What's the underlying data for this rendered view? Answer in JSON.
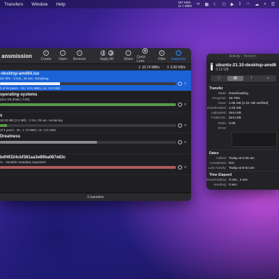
{
  "menubar": {
    "items": [
      "Transfers",
      "Window",
      "Help"
    ],
    "speed_up": "357 KB/s",
    "speed_down": "11.7 MB/s"
  },
  "window": {
    "title": "ansmission",
    "toolbar": [
      "Create",
      "Open",
      "Remove",
      "Apply All",
      "Share",
      "Quick Look",
      "Filter",
      "Inspector"
    ],
    "stats_down": "⇓ 10.74 MB/s",
    "stats_up": "⇑ 0.00 KB/s",
    "transfers": [
      {
        "name": "-desktop-amd64.iso",
        "status": "33.78% - 3 min., 40 sec. remaining",
        "detail": "3 of 93 peers - DL: 9.01 MB/s, UL: 0.0 KB/s",
        "progress": 0.34,
        "color": "#e9eef9",
        "selected": true
      },
      {
        "name": "operating-systems",
        "status": "Zero KB (Ratio: 0.00)",
        "detail": "",
        "progress": 1.0,
        "color": "#5a9a4a",
        "selected": false
      },
      {
        "name": "s",
        "status": "10.03 MB (2.2 MB) - 2 hrs, 35 sec. remaining",
        "detail": "of 3 peers - DL: 1.73 MB/s, UL: 0.0 KB/s",
        "progress": 0.04,
        "color": "#5a9a4a",
        "selected": false
      },
      {
        "name": "Dreatness",
        "status": "",
        "detail": "",
        "progress": 0.55,
        "color": "#8a8a8f",
        "selected": false
      },
      {
        "name": "bdf4f324cbf381aa3e89ba087e83c",
        "status": "% - Variable metadata requested",
        "detail": "",
        "progress": 1.0,
        "color": "#b05a5a",
        "selected": false
      }
    ],
    "footer": "5 transfers"
  },
  "inspector": {
    "window_title": "Activity - Torrent I",
    "file_name": "ubuntu-21.10-desktop-amd6",
    "file_size": "3.12 GB",
    "transfer_heading": "Transfer",
    "transfer": [
      {
        "k": "State:",
        "v": "Downloading"
      },
      {
        "k": "Progress:",
        "v": "33.78%"
      },
      {
        "k": "Have:",
        "v": "1.05 GB (1.01 GB verified)"
      },
      {
        "k": "Downloaded:",
        "v": "1.03 GB"
      },
      {
        "k": "Uploaded:",
        "v": "Zero KB"
      },
      {
        "k": "Failed DL:",
        "v": "Zero KB"
      },
      {
        "k": "Ratio:",
        "v": "0.00"
      },
      {
        "k": "Error:",
        "v": ""
      }
    ],
    "dates_heading": "Dates",
    "dates": [
      {
        "k": "Added:",
        "v": "Today at 6:36 am"
      },
      {
        "k": "Completed:",
        "v": "N/A"
      },
      {
        "k": "Last Activity:",
        "v": "Today at 6:54 am"
      }
    ],
    "elapsed_heading": "Time Elapsed",
    "elapsed": [
      {
        "k": "Downloading:",
        "v": "3 min., 4 sec."
      },
      {
        "k": "Seeding:",
        "v": "0 sec."
      }
    ]
  }
}
